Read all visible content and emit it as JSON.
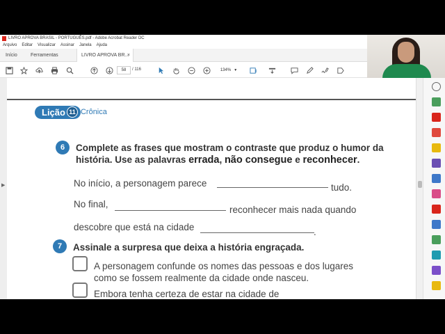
{
  "window": {
    "title": "LIVRO APROVA BRASIL - PORTUGUÊS.pdf - Adobe Acrobat Reader DC"
  },
  "menu": [
    "Arquivo",
    "Editar",
    "Visualizar",
    "Assinar",
    "Janela",
    "Ajuda"
  ],
  "tabs": {
    "home": "Início",
    "tools": "Ferramentas",
    "doc": "LIVRO APROVA BR...",
    "close": "×"
  },
  "toolbar": {
    "page_current": "58",
    "page_total": "/ 116",
    "zoom": "134%"
  },
  "lesson": {
    "label": "Lição",
    "number": "11",
    "name": "Crônica"
  },
  "q6": {
    "number": "6",
    "prompt_a": "Complete as frases que mostram o contraste que produz o humor da",
    "prompt_b1": "história. Use as palavras ",
    "word1": "errada",
    "comma": ", ",
    "word2": "não consegue",
    "and": " e ",
    "word3": "reconhecer",
    "period": ".",
    "line1_start": "No início, a personagem parece",
    "line1_end": "tudo.",
    "line2_start": "No final,",
    "line2_end": "reconhecer mais nada quando",
    "line3_start": "descobre que está na cidade",
    "line3_end": "."
  },
  "q7": {
    "number": "7",
    "prompt": "Assinale a surpresa que deixa a história engraçada.",
    "option1_a": "A personagem confunde os nomes das pessoas e dos lugares",
    "option1_b": "como se fossem realmente da cidade onde nasceu.",
    "option2_a": "Embora tenha certeza de estar na cidade de"
  },
  "icons": {
    "save": "save-icon",
    "bookmark": "star-icon",
    "upload": "upload-icon",
    "print": "print-icon",
    "search": "search-icon",
    "prev": "arrow-up-icon",
    "next": "arrow-down-icon",
    "select": "cursor-icon",
    "hand": "hand-icon",
    "zoom_out": "zoom-out-icon",
    "zoom_in": "zoom-in-icon"
  },
  "colors": {
    "accent": "#2f7ab5",
    "pdf_red": "#d9261c"
  }
}
